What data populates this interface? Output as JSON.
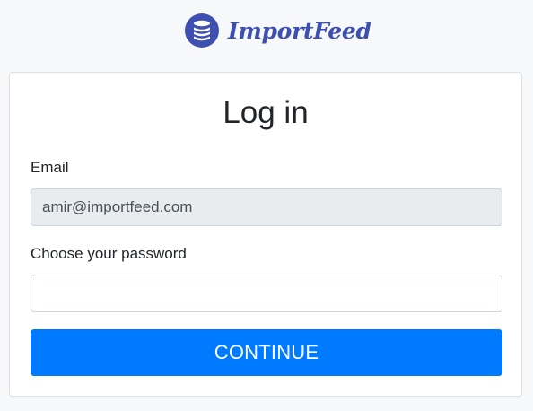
{
  "brand": {
    "name": "ImportFeed",
    "logo_icon": "stacked-coins-icon",
    "color": "#3d4fb1"
  },
  "login": {
    "title": "Log in",
    "email_label": "Email",
    "email_value": "amir@importfeed.com",
    "password_label": "Choose your password",
    "password_value": "",
    "submit_label": "CONTINUE"
  },
  "colors": {
    "primary": "#007bff",
    "readonly_field": "#e9ecef",
    "background": "#f7f8fa"
  }
}
